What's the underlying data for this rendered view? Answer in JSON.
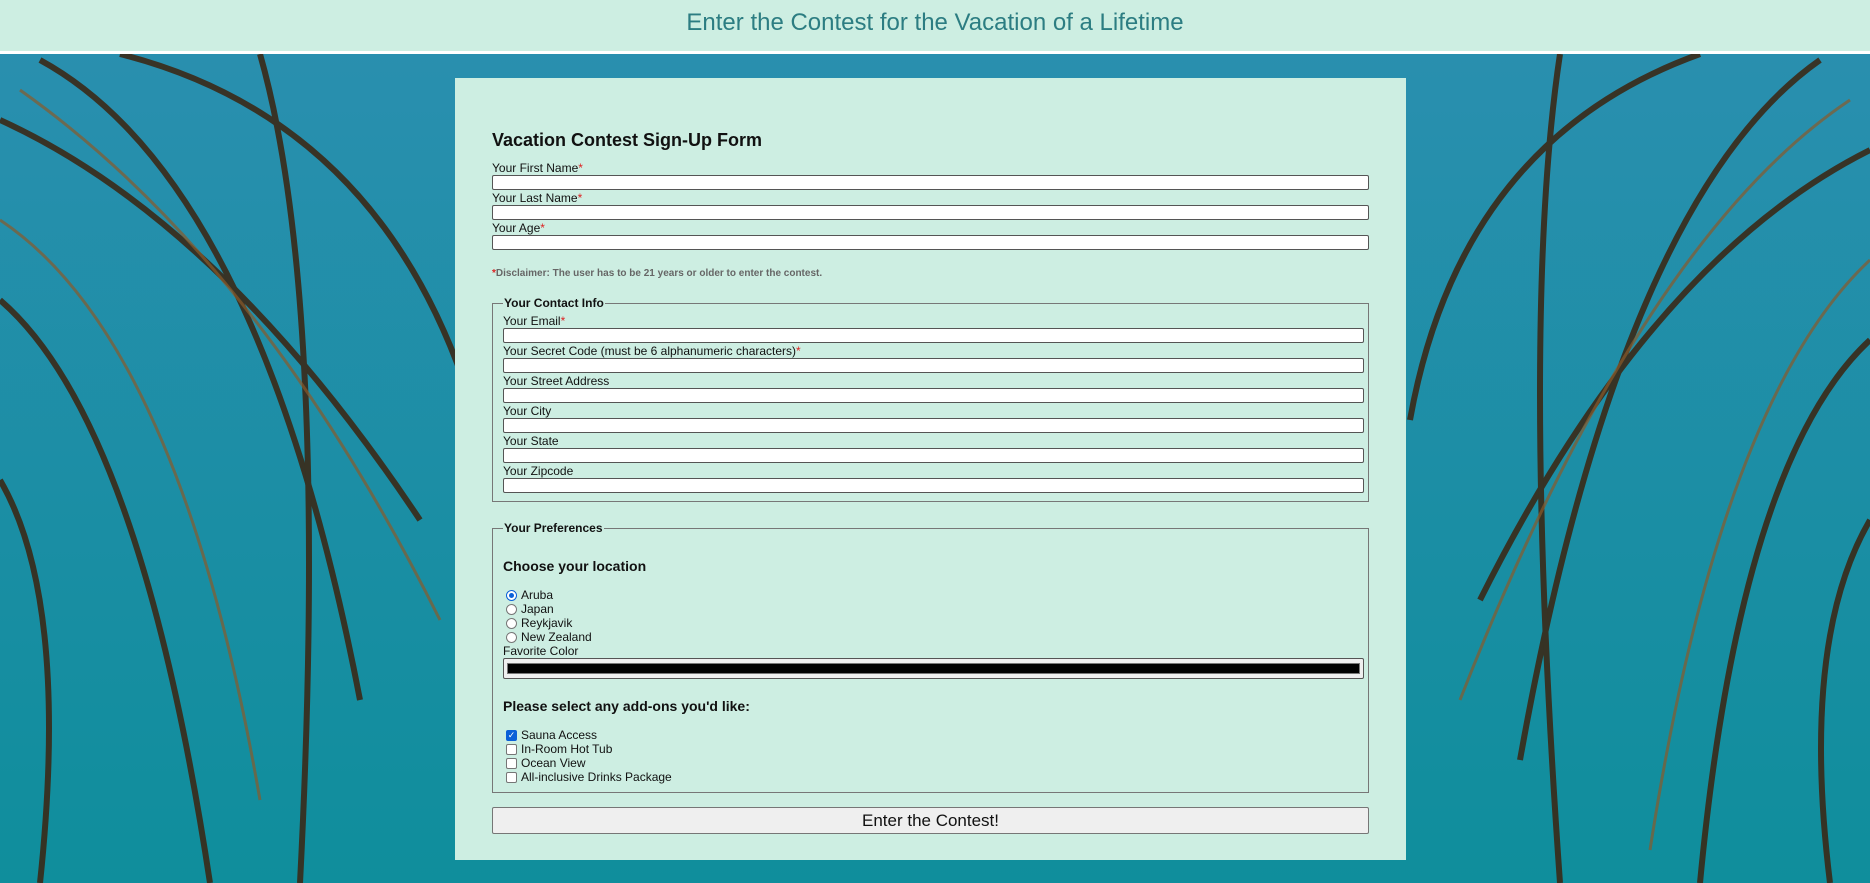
{
  "header": {
    "title": "Enter the Contest for the Vacation of a Lifetime"
  },
  "form": {
    "title": "Vacation Contest Sign-Up Form",
    "required_mark": "*",
    "first_name": {
      "label": "Your First Name",
      "value": ""
    },
    "last_name": {
      "label": "Your Last Name",
      "value": ""
    },
    "age": {
      "label": "Your Age",
      "value": ""
    },
    "disclaimer": {
      "mark": "*",
      "text": "Disclaimer: The user has to be 21 years or older to enter the contest."
    },
    "contact": {
      "legend": "Your Contact Info",
      "email": {
        "label": "Your Email",
        "value": ""
      },
      "secret_code": {
        "label": "Your Secret Code (must be 6 alphanumeric characters)",
        "value": ""
      },
      "street": {
        "label": "Your Street Address",
        "value": ""
      },
      "city": {
        "label": "Your City",
        "value": ""
      },
      "state": {
        "label": "Your State",
        "value": ""
      },
      "zipcode": {
        "label": "Your Zipcode",
        "value": ""
      }
    },
    "preferences": {
      "legend": "Your Preferences",
      "location_heading": "Choose your location",
      "locations": [
        {
          "label": "Aruba",
          "selected": true
        },
        {
          "label": "Japan",
          "selected": false
        },
        {
          "label": "Reykjavik",
          "selected": false
        },
        {
          "label": "New Zealand",
          "selected": false
        }
      ],
      "color_label": "Favorite Color",
      "color_value": "#000000",
      "addons_heading": "Please select any add-ons you'd like:",
      "addons": [
        {
          "label": "Sauna Access",
          "checked": true
        },
        {
          "label": "In-Room Hot Tub",
          "checked": false
        },
        {
          "label": "Ocean View",
          "checked": false
        },
        {
          "label": "All-inclusive Drinks Package",
          "checked": false
        }
      ]
    },
    "submit_label": "Enter the Contest!"
  },
  "colors": {
    "header_bg": "#cdeee2",
    "header_text": "#2c7d82",
    "card_bg": "#cdeee2",
    "sky": "#1d8aa0",
    "required": "#dd2222",
    "accent": "#0a60d8"
  }
}
